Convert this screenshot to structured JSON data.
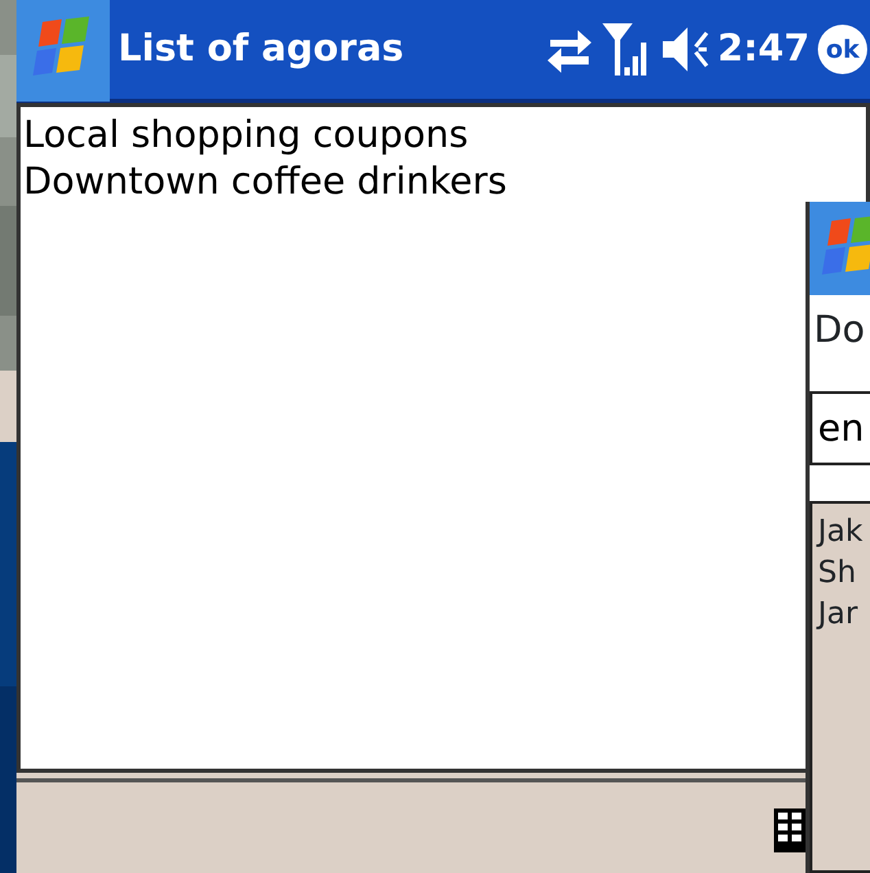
{
  "main_window": {
    "title": "List of agoras",
    "clock": "2:47",
    "ok_button": "ok",
    "items": [
      {
        "label": "Local shopping coupons"
      },
      {
        "label": "Downtown coffee drinkers"
      }
    ]
  },
  "second_window": {
    "heading": "Do",
    "field": {
      "value": "en"
    },
    "list_items": [
      {
        "label": "Jak"
      },
      {
        "label": "Sh"
      },
      {
        "label": "Jar"
      }
    ]
  }
}
